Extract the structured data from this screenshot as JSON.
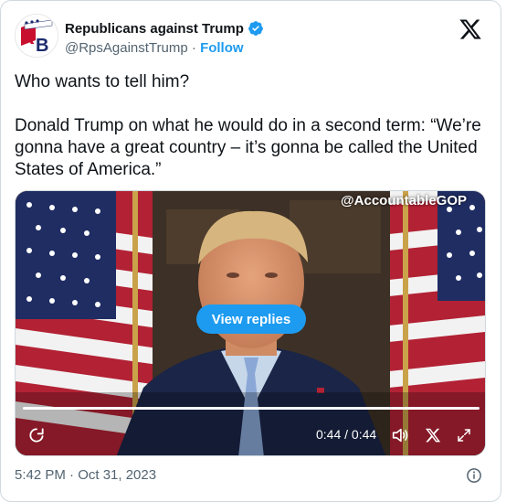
{
  "account": {
    "display_name": "Republicans against Trump",
    "handle": "@RpsAgainstTrump",
    "separator": " · ",
    "follow_label": "Follow",
    "avatar_letters": "RB",
    "verified": true
  },
  "tweet": {
    "line1": "Who wants to tell him?",
    "line2": "Donald Trump on what he would do in a second term: “We’re gonna have a great country – it’s gonna be called the United States of America.”",
    "timestamp": "5:42 PM · Oct 31, 2023"
  },
  "video": {
    "watermark": "@AccountableGOP",
    "view_replies_label": "View replies",
    "time_display": "0:44 / 0:44",
    "progress": 1.0
  },
  "icons": {
    "brand": "x-logo-icon",
    "verified": "verified-badge-icon",
    "replay": "replay-icon",
    "volume": "volume-icon",
    "fullscreen": "expand-icon",
    "info": "info-icon"
  },
  "colors": {
    "accent": "#1d9bf0",
    "text": "#0f1419",
    "muted": "#536471",
    "border": "#cfd9de"
  }
}
